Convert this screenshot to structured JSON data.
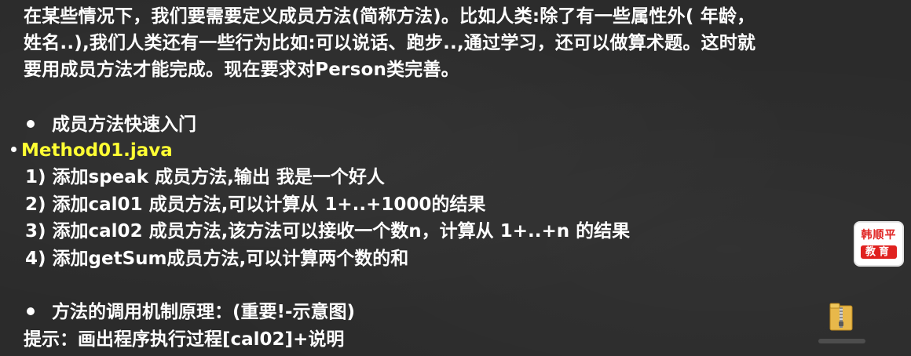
{
  "intro": {
    "line1": "在某些情况下，我们要需要定义成员方法(简称方法)。比如人类:除了有一些属性外( 年龄，",
    "line2": "姓名..),我们人类还有一些行为比如:可以说话、跑步..,通过学习，还可以做算术题。这时就",
    "line3": "要用成员方法才能完成。现在要求对Person类完善。"
  },
  "section1": {
    "heading": "成员方法快速入门",
    "filename": "Method01.java",
    "items": [
      "1) 添加speak 成员方法,输出 我是一个好人",
      "2) 添加cal01 成员方法,可以计算从 1+..+1000的结果",
      "3) 添加cal02 成员方法,该方法可以接收一个数n，计算从 1+..+n 的结果",
      "4) 添加getSum成员方法,可以计算两个数的和"
    ]
  },
  "section2": {
    "heading": "方法的调用机制原理：(重要!-示意图)",
    "hint": "提示：画出程序执行过程[cal02]+说明"
  },
  "badge": {
    "top": "韩顺平",
    "bottom": "教育"
  },
  "colors": {
    "background": "#2b2b2b",
    "text": "#ffffff",
    "highlight": "#ffff33",
    "badge_red": "#e0211f"
  },
  "icons": {
    "desktop_icon": "zip-folder-icon",
    "bullet": "bullet-icon"
  }
}
